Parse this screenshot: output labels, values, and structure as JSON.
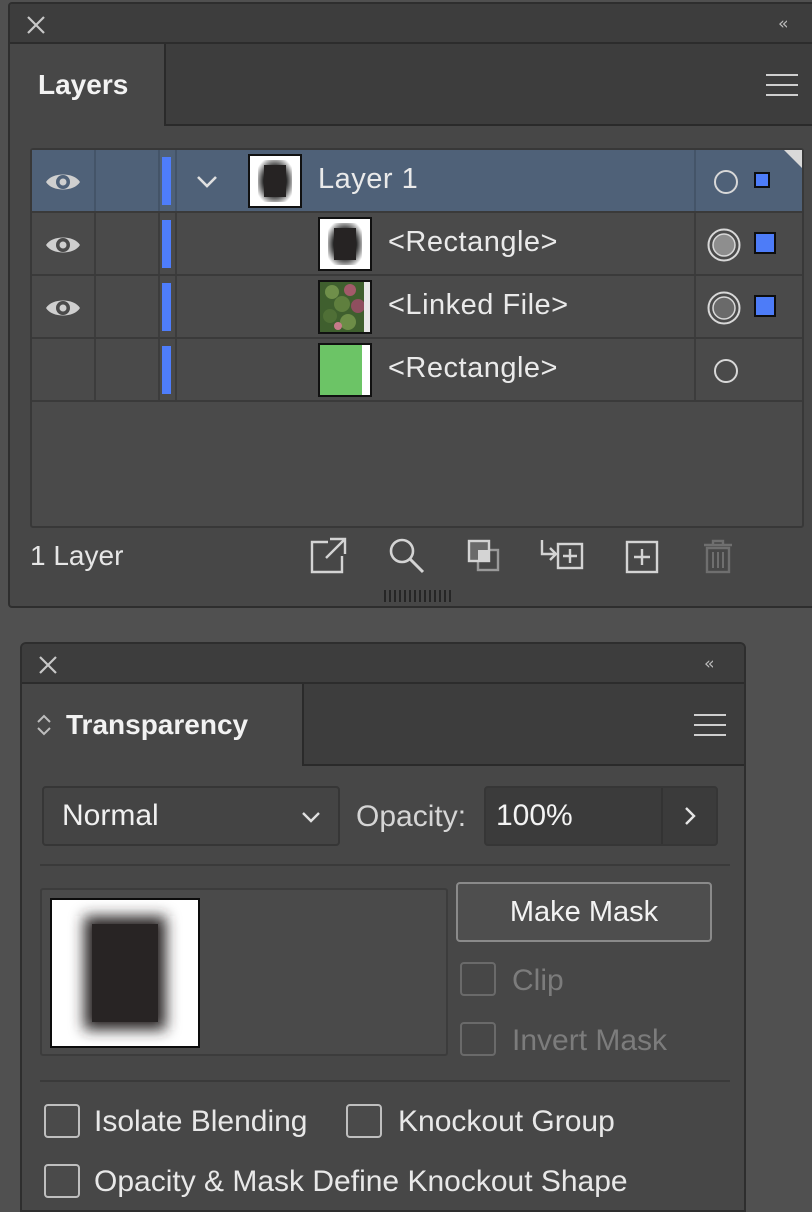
{
  "layers_panel": {
    "tab_label": "Layers",
    "rows": [
      {
        "label": "Layer 1",
        "selected": true
      },
      {
        "label": "<Rectangle>"
      },
      {
        "label": "<Linked File>"
      },
      {
        "label": "<Rectangle>"
      }
    ],
    "footer_count": "1 Layer",
    "footer_icons": [
      "export-icon",
      "search-icon",
      "make-clipping-mask-icon",
      "new-sublayer-icon",
      "new-layer-icon",
      "trash-icon"
    ],
    "layer_color": "#4e7dfb"
  },
  "transparency_panel": {
    "tab_label": "Transparency",
    "blend_mode": "Normal",
    "opacity_label": "Opacity:",
    "opacity_value": "100%",
    "make_mask_label": "Make Mask",
    "clip_label": "Clip",
    "invert_mask_label": "Invert Mask",
    "isolate_blending_label": "Isolate Blending",
    "knockout_group_label": "Knockout Group",
    "knockout_shape_label": "Opacity & Mask Define Knockout Shape"
  }
}
